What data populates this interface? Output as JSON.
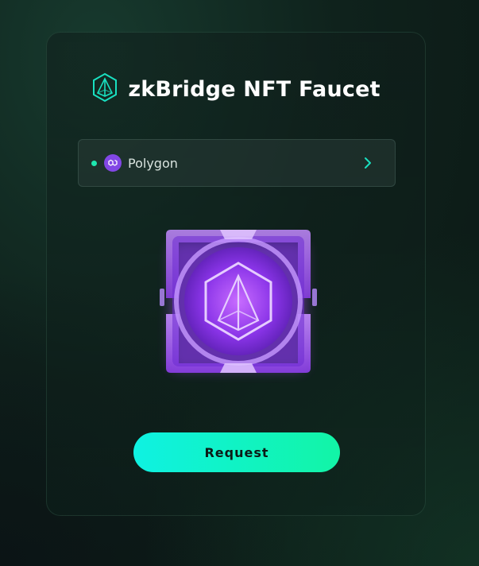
{
  "header": {
    "title": "zkBridge NFT Faucet",
    "logo_icon": "hexagon-pyramid-icon"
  },
  "network_select": {
    "label": "Polygon",
    "icon": "polygon-icon",
    "status_color": "#1ee8b0",
    "chevron": "chevron-right-icon"
  },
  "nft": {
    "icon": "hexagon-pyramid-icon"
  },
  "actions": {
    "request_label": "Request"
  },
  "colors": {
    "accent": "#14f0c0",
    "polygon": "#8247e5",
    "nft_purple": "#a04cf5"
  }
}
